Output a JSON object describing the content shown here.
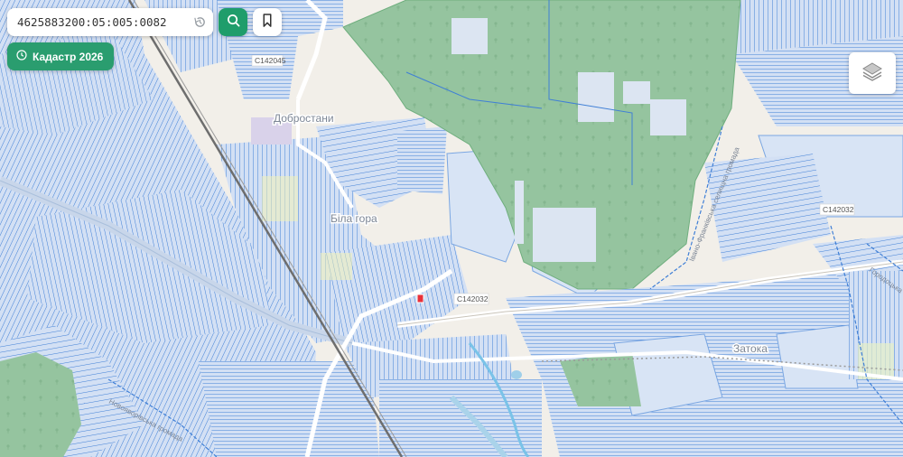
{
  "search": {
    "value": "4625883200:05:005:0082",
    "history_icon": "history-icon",
    "search_icon": "search-icon"
  },
  "bookmark": {
    "icon": "bookmark-icon"
  },
  "kadastr_button": {
    "label": "Кадастр 2026",
    "icon": "clock-icon"
  },
  "layers_button": {
    "icon": "layers-icon"
  },
  "map": {
    "places": {
      "dobrostany": "Добростани",
      "bila_hora": "Біла гора",
      "zatoka": "Затока"
    },
    "roads": {
      "c142045": "C142045",
      "c142032_a": "C142032",
      "c142032_b": "C142032"
    },
    "boundaries": {
      "novoiavorivska": "Новояворівська громада",
      "ivano_frankivska": "Івано-Франківська селищна громада",
      "horodotska": "Городоцька"
    },
    "colors": {
      "background": "#f2efe9",
      "forest": "#95c49f",
      "parcel_fill": "#d8e4f5",
      "parcel_line": "#4a86d8",
      "selected_parcel": "#e8303a",
      "accent": "#1f9d6b"
    }
  }
}
